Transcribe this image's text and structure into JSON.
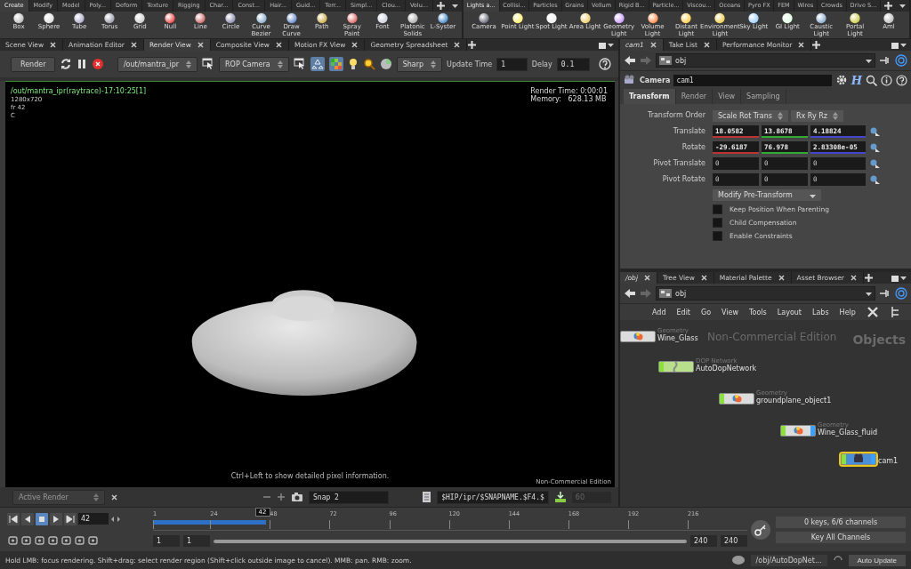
{
  "shelf_left": {
    "tabs": [
      {
        "label": "Create",
        "selected": true
      },
      {
        "label": "Modify",
        "selected": false
      },
      {
        "label": "Model",
        "selected": false
      },
      {
        "label": "Poly...",
        "selected": false
      },
      {
        "label": "Deform",
        "selected": false
      },
      {
        "label": "Texture",
        "selected": false
      },
      {
        "label": "Rigging",
        "selected": false
      },
      {
        "label": "Char...",
        "selected": false
      },
      {
        "label": "Const...",
        "selected": false
      },
      {
        "label": "Hair...",
        "selected": false
      },
      {
        "label": "Guid...",
        "selected": false
      },
      {
        "label": "Terr...",
        "selected": false
      },
      {
        "label": "Simpl...",
        "selected": false
      },
      {
        "label": "Clou...",
        "selected": false
      },
      {
        "label": "Volu...",
        "selected": false
      }
    ],
    "tools": [
      "Box",
      "Sphere",
      "Tube",
      "Torus",
      "Grid",
      "Null",
      "Line",
      "Circle",
      "Curve Bezier",
      "Draw Curve",
      "Path",
      "Spray Paint",
      "Font",
      "Platonic Solids",
      "L-Syster"
    ]
  },
  "shelf_right": {
    "tabs": [
      {
        "label": "Lights a...",
        "selected": true
      },
      {
        "label": "Collisi...",
        "selected": false
      },
      {
        "label": "Particles",
        "selected": false
      },
      {
        "label": "Grains",
        "selected": false
      },
      {
        "label": "Vellum",
        "selected": false
      },
      {
        "label": "Rigid B...",
        "selected": false
      },
      {
        "label": "Particle...",
        "selected": false
      },
      {
        "label": "Viscou...",
        "selected": false
      },
      {
        "label": "Oceans",
        "selected": false
      },
      {
        "label": "Pyro FX",
        "selected": false
      },
      {
        "label": "FEM",
        "selected": false
      },
      {
        "label": "Wires",
        "selected": false
      },
      {
        "label": "Crowds",
        "selected": false
      },
      {
        "label": "Drive S...",
        "selected": false
      }
    ],
    "tools": [
      "Camera",
      "Point Light",
      "Spot Light",
      "Area Light",
      "Geometry Light",
      "Volume Light",
      "Distant Light",
      "Environment Light",
      "Sky Light",
      "GI Light",
      "Caustic Light",
      "Portal Light",
      "Aml"
    ]
  },
  "render_pane": {
    "tabs": [
      {
        "label": "Scene View",
        "selected": false
      },
      {
        "label": "Animation Editor",
        "selected": false
      },
      {
        "label": "Render View",
        "selected": true
      },
      {
        "label": "Composite View",
        "selected": false
      },
      {
        "label": "Motion FX View",
        "selected": false
      },
      {
        "label": "Geometry Spreadsheet",
        "selected": false
      }
    ],
    "toolbar": {
      "render_button": "Render",
      "rop": "/out/mantra_ipr",
      "camera": "ROP Camera",
      "preview": "Sharp",
      "update_time_label": "Update Time",
      "update_time": "1",
      "delay_label": "Delay",
      "delay": "0.1",
      "toggles": [
        {
          "on": true
        },
        {
          "on": true
        }
      ]
    },
    "viewport": {
      "title": "/out/mantra_ipr(raytrace)-17:10:25[1]",
      "info": [
        "1280x720",
        "fr 42",
        "C"
      ],
      "render_time": "Render Time: 0:00:01",
      "memory_label": "Memory:",
      "memory": "628.13 MB",
      "hint": "Ctrl+Left to show detailed pixel information.",
      "edition": "Non-Commercial Edition"
    },
    "snapshot_bar": {
      "mode": "Active Render",
      "snapshot": "Snap 2",
      "path": "$HIP/ipr/$SNAPNAME.$F4.$",
      "frame": "60"
    }
  },
  "parameters": {
    "tabs": [
      {
        "label": "cam1",
        "selected": true
      },
      {
        "label": "Take List",
        "selected": false
      },
      {
        "label": "Performance Monitor",
        "selected": false
      }
    ],
    "path": "obj",
    "node_type": "Camera",
    "node_name": "cam1",
    "asset_badge": "H",
    "param_tabs": [
      {
        "label": "Transform",
        "selected": true
      },
      {
        "label": "Render",
        "selected": false
      },
      {
        "label": "View",
        "selected": false
      },
      {
        "label": "Sampling",
        "selected": false
      }
    ],
    "transform_order": {
      "label": "Transform Order",
      "values": [
        "Scale Rot Trans",
        "Rx Ry Rz"
      ]
    },
    "vectors": [
      {
        "label": "Translate",
        "values": [
          "18.0582",
          "13.8678",
          "4.18824"
        ],
        "animated": true
      },
      {
        "label": "Rotate",
        "values": [
          "-29.6187",
          "76.978",
          "2.83308e-05"
        ],
        "animated": true
      },
      {
        "label": "Pivot Translate",
        "values": [
          "0",
          "0",
          "0"
        ],
        "animated": false
      },
      {
        "label": "Pivot Rotate",
        "values": [
          "0",
          "0",
          "0"
        ],
        "animated": false
      }
    ],
    "button": "Modify Pre-Transform",
    "checkboxes": [
      {
        "label": "Keep Position When Parenting",
        "checked": false
      },
      {
        "label": "Child Compensation",
        "checked": false
      },
      {
        "label": "Enable Constraints",
        "checked": false
      }
    ]
  },
  "network": {
    "tabs": [
      {
        "label": "/obj",
        "selected": true
      },
      {
        "label": "Tree View",
        "selected": false
      },
      {
        "label": "Material Palette",
        "selected": false
      },
      {
        "label": "Asset Browser",
        "selected": false
      }
    ],
    "path": "obj",
    "menu": [
      "Add",
      "Edit",
      "Go",
      "View",
      "Tools",
      "Layout",
      "Labs",
      "Help"
    ],
    "edition": "Non-Commercial Edition",
    "context": "Objects",
    "nodes": [
      {
        "kind": "geo",
        "type": "Geometry",
        "name": "Wine_Glass",
        "color": "#dcdcdc",
        "selectable": false,
        "display": false,
        "selected": false
      },
      {
        "kind": "dop",
        "type": "DOP Network",
        "name": "AutoDopNetwork",
        "color": "#b8e08c",
        "selectable": true,
        "display": false,
        "selected": false
      },
      {
        "kind": "geo",
        "type": "Geometry",
        "name": "groundplane_object1",
        "color": "#dcdcdc",
        "selectable": true,
        "display": false,
        "selected": false
      },
      {
        "kind": "geo",
        "type": "Geometry",
        "name": "Wine_Glass_fluid",
        "color": "#dcdcdc",
        "selectable": true,
        "display": true,
        "selected": false
      },
      {
        "kind": "cam",
        "name": "cam1",
        "color": "#4a8fd8",
        "selectable": true,
        "display": true,
        "selected": true
      }
    ]
  },
  "timeline": {
    "frame": "42",
    "ticks": [
      "1",
      "24",
      "48",
      "72",
      "96",
      "120",
      "144",
      "168",
      "192",
      "216"
    ],
    "current": "42",
    "level": 0.19,
    "playback_range": {
      "level": 1
    },
    "start": "1",
    "start_field": "1",
    "end_field": "240",
    "end": "240",
    "keys": "0 keys, 6/6 channels",
    "key_all": "Key All Channels"
  },
  "status_bar": {
    "message": "Hold LMB: focus rendering. Shift+drag: select render region (Shift+click outside image to cancel). MMB: pan. RMB: zoom.",
    "path": "/obj/AutoDopNet...",
    "update": "Auto Update"
  }
}
